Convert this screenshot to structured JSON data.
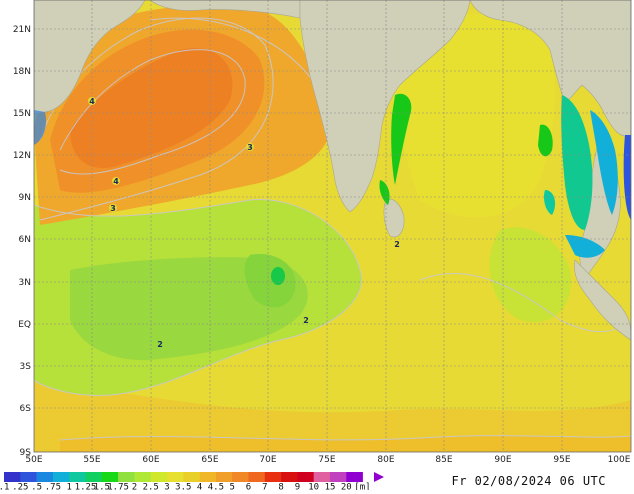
{
  "map": {
    "lon_labels": [
      "50E",
      "55E",
      "60E",
      "65E",
      "70E",
      "75E",
      "80E",
      "85E",
      "90E",
      "95E",
      "100E"
    ],
    "lat_labels": [
      "21N",
      "18N",
      "15N",
      "12N",
      "9N",
      "6N",
      "3N",
      "EQ",
      "3S",
      "6S",
      "9S"
    ],
    "contour_labels": [
      "4",
      "4",
      "3",
      "3",
      "3",
      "2",
      "2",
      "2"
    ]
  },
  "legend": {
    "values": [
      ".1",
      ".25",
      ".5",
      ".75",
      "1",
      "1.25",
      "1.5",
      "1.75",
      "2",
      "2.5",
      "3",
      "3.5",
      "4",
      "4.5",
      "5",
      "6",
      "7",
      "8",
      "9",
      "10",
      "15",
      "20"
    ],
    "unit": "[m]",
    "colors": [
      "#3333cc",
      "#2f55dd",
      "#1a88e0",
      "#12b0d8",
      "#10c8a0",
      "#12d060",
      "#18d818",
      "#90e040",
      "#b0e838",
      "#d0e82c",
      "#e8e030",
      "#e8d028",
      "#f0b828",
      "#f0a028",
      "#f08828",
      "#f06820",
      "#e83010",
      "#d81010",
      "#d00020",
      "#e060a0",
      "#c040c0",
      "#9000d0"
    ]
  },
  "timestamp": "Fr 02/08/2024 06 UTC"
}
